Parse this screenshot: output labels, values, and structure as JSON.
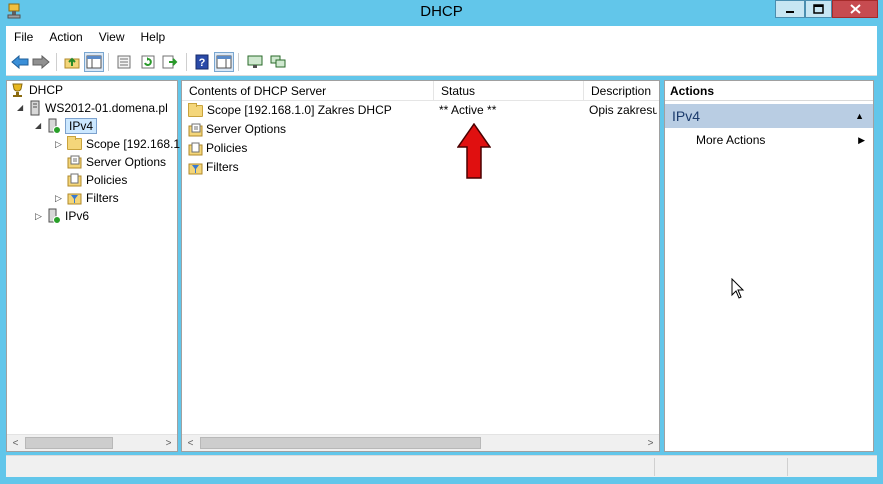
{
  "window": {
    "title": "DHCP"
  },
  "menubar": {
    "items": [
      "File",
      "Action",
      "View",
      "Help"
    ]
  },
  "tree": {
    "root": "DHCP",
    "server": "WS2012-01.domena.pl",
    "ipv4": "IPv4",
    "scope": "Scope [192.168.1",
    "server_options": "Server Options",
    "policies": "Policies",
    "filters": "Filters",
    "ipv6": "IPv6"
  },
  "list": {
    "columns": [
      "Contents of DHCP Server",
      "Status",
      "Description"
    ],
    "rows": [
      {
        "name": "Scope [192.168.1.0] Zakres DHCP",
        "status": "** Active **",
        "description": "Opis zakresu",
        "icon": "folder-icon"
      },
      {
        "name": "Server Options",
        "status": "",
        "description": "",
        "icon": "server-options-icon"
      },
      {
        "name": "Policies",
        "status": "",
        "description": "",
        "icon": "policies-icon"
      },
      {
        "name": "Filters",
        "status": "",
        "description": "",
        "icon": "filter-icon"
      }
    ]
  },
  "actions": {
    "header": "Actions",
    "group": "IPv4",
    "more": "More Actions"
  },
  "annotation": {
    "color": "#e01010"
  },
  "colors": {
    "window_bg": "#62c6ea",
    "actions_group_bg": "#b9cde3",
    "selection_bg": "#cce8ff"
  }
}
